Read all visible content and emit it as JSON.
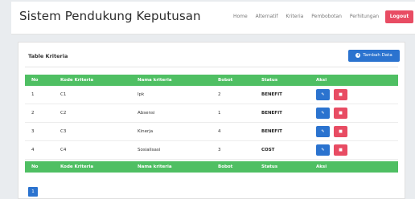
{
  "header": {
    "brand": "Sistem Pendukung Keputusan",
    "nav": [
      "Home",
      "Alternatif",
      "Kriteria",
      "Pembobotan",
      "Perhitungan"
    ],
    "logout_label": "Logout"
  },
  "card": {
    "title": "Table Kriteria",
    "add_button_label": "Tambah Data"
  },
  "table": {
    "columns": [
      "No",
      "Kode Kriteria",
      "Nama kriteria",
      "Bobot",
      "Status",
      "Aksi"
    ],
    "rows": [
      {
        "no": "1",
        "kode": "C1",
        "nama": "Ipk",
        "bobot": "2",
        "status": "BENEFIT"
      },
      {
        "no": "2",
        "kode": "C2",
        "nama": "Absensi",
        "bobot": "1",
        "status": "BENEFIT"
      },
      {
        "no": "3",
        "kode": "C3",
        "nama": "Kinerja",
        "bobot": "4",
        "status": "BENEFIT"
      },
      {
        "no": "4",
        "kode": "C4",
        "nama": "Sosialisasi",
        "bobot": "3",
        "status": "COST"
      }
    ]
  },
  "pagination": {
    "current": "1"
  },
  "colors": {
    "header_green": "#4fbf63",
    "primary_blue": "#2b73cf",
    "danger_red": "#e84c63"
  },
  "icons": {
    "add": "plus-circle-icon",
    "edit": "edit-icon",
    "delete": "trash-icon"
  }
}
